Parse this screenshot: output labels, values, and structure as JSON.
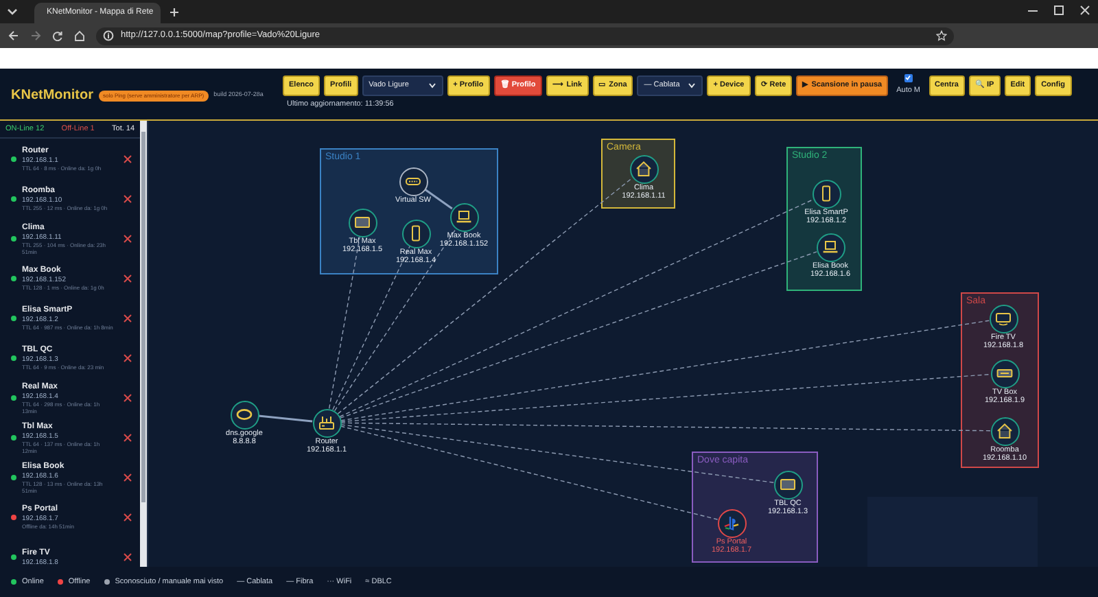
{
  "browser": {
    "tab_title": "KNetMonitor - Mappa di Rete",
    "url": "http://127.0.0.1:5000/map?profile=Vado%20Ligure"
  },
  "header": {
    "title": "KNetMonitor",
    "badge": "solo Ping (serve amministratore per ARP)",
    "build": "build 2026-07-28a",
    "last_update": "Ultimo aggiornamento: 11:39:56",
    "controls": [
      {
        "kind": "button",
        "label": "Elenco"
      },
      {
        "kind": "button",
        "label": "Profili"
      },
      {
        "kind": "select",
        "value": "Vado Ligure"
      },
      {
        "kind": "button",
        "label": "+ Profilo"
      },
      {
        "kind": "danger",
        "label": "🗑 Profilo"
      },
      {
        "kind": "button",
        "label": "⟶ Link"
      },
      {
        "kind": "button",
        "label": "▭ Zona"
      },
      {
        "kind": "select",
        "value": "— Cablata"
      },
      {
        "kind": "button",
        "label": "+ Device"
      },
      {
        "kind": "button",
        "label": "⟳ Rete"
      },
      {
        "kind": "scan",
        "label": "▶ Scansione in pausa"
      },
      {
        "kind": "checkbox",
        "label": "Auto M",
        "checked": true
      },
      {
        "kind": "button",
        "label": "Centra"
      },
      {
        "kind": "button",
        "label": "🔍 IP"
      },
      {
        "kind": "button",
        "label": "Edit"
      },
      {
        "kind": "button",
        "label": "Config"
      }
    ]
  },
  "sidebar": {
    "online_count": "ON-Line 12",
    "offline_count": "Off-Line 1",
    "total": "Tot. 14",
    "devices": [
      {
        "name": "Router",
        "ip": "192.168.1.1",
        "detail": "TTL 64 · 8 ms · Online da: 1g 0h",
        "offline": false
      },
      {
        "name": "Roomba",
        "ip": "192.168.1.10",
        "detail": "TTL 255 · 12 ms · Online da: 1g 0h",
        "offline": false
      },
      {
        "name": "Clima",
        "ip": "192.168.1.11",
        "detail": "TTL 255 · 104 ms · Online da: 23h 51min",
        "offline": false
      },
      {
        "name": "Max Book",
        "ip": "192.168.1.152",
        "detail": "TTL 128 · 1 ms · Online da: 1g 0h",
        "offline": false
      },
      {
        "name": "Elisa SmartP",
        "ip": "192.168.1.2",
        "detail": "TTL 64 · 987 ms · Online da: 1h 8min",
        "offline": false
      },
      {
        "name": "TBL QC",
        "ip": "192.168.1.3",
        "detail": "TTL 64 · 9 ms · Online da: 23 min",
        "offline": false
      },
      {
        "name": "Real Max",
        "ip": "192.168.1.4",
        "detail": "TTL 64 · 298 ms · Online da: 1h 13min",
        "offline": false
      },
      {
        "name": "Tbl Max",
        "ip": "192.168.1.5",
        "detail": "TTL 64 · 137 ms · Online da: 1h 12min",
        "offline": false
      },
      {
        "name": "Elisa Book",
        "ip": "192.168.1.6",
        "detail": "TTL 128 · 13 ms · Online da: 13h 51min",
        "offline": false
      },
      {
        "name": "Ps Portal",
        "ip": "192.168.1.7",
        "detail": "Offline da: 14h 51min",
        "offline": true
      },
      {
        "name": "Fire TV",
        "ip": "192.168.1.8",
        "offline": false
      }
    ]
  },
  "map": {
    "zones": [
      {
        "name": "Studio 1",
        "color": "#3b82c4"
      },
      {
        "name": "Camera",
        "color": "#d4b83a"
      },
      {
        "name": "Studio 2",
        "color": "#2fb37a"
      },
      {
        "name": "Sala",
        "color": "#d04848"
      },
      {
        "name": "Dove capita",
        "color": "#8a5cc0"
      }
    ],
    "nodes": [
      {
        "name": "Router",
        "ip": "192.168.1.1",
        "kind": "router",
        "offline": false
      },
      {
        "name": "dns.google",
        "ip": "8.8.8.8",
        "kind": "globe",
        "offline": false
      },
      {
        "name": "Virtual SW",
        "kind": "switch",
        "offline": false
      },
      {
        "name": "Tbl Max",
        "ip": "192.168.1.5",
        "kind": "tablet",
        "offline": false
      },
      {
        "name": "Real Max",
        "ip": "192.168.1.4",
        "kind": "phone",
        "offline": false
      },
      {
        "name": "Max Book",
        "ip": "192.168.1.152",
        "kind": "laptop",
        "offline": false
      },
      {
        "name": "Clima",
        "ip": "192.168.1.11",
        "kind": "home",
        "offline": false
      },
      {
        "name": "Elisa SmartP",
        "ip": "192.168.1.2",
        "kind": "phone",
        "offline": false
      },
      {
        "name": "Elisa Book",
        "ip": "192.168.1.6",
        "kind": "laptop",
        "offline": false
      },
      {
        "name": "Fire TV",
        "ip": "192.168.1.8",
        "kind": "tv",
        "offline": false
      },
      {
        "name": "TV Box",
        "ip": "192.168.1.9",
        "kind": "tvbox",
        "offline": false
      },
      {
        "name": "Roomba",
        "ip": "192.168.1.10",
        "kind": "home",
        "offline": false
      },
      {
        "name": "TBL QC",
        "ip": "192.168.1.3",
        "kind": "tablet",
        "offline": false
      },
      {
        "name": "Ps Portal",
        "ip": "192.168.1.7",
        "kind": "console",
        "offline": true
      }
    ]
  },
  "legend": [
    {
      "kind": "dot",
      "label": "Online",
      "color": "#22c55e"
    },
    {
      "kind": "dot",
      "label": "Offline",
      "color": "#ef4444"
    },
    {
      "kind": "dot",
      "label": "Sconosciuto / manuale mai visto",
      "color": "#9ca3af"
    },
    {
      "kind": "line",
      "label": "— Cablata"
    },
    {
      "kind": "line",
      "label": "— Fibra"
    },
    {
      "kind": "line",
      "label": "··· WiFi"
    },
    {
      "kind": "line",
      "label": "≈ DBLC"
    }
  ]
}
